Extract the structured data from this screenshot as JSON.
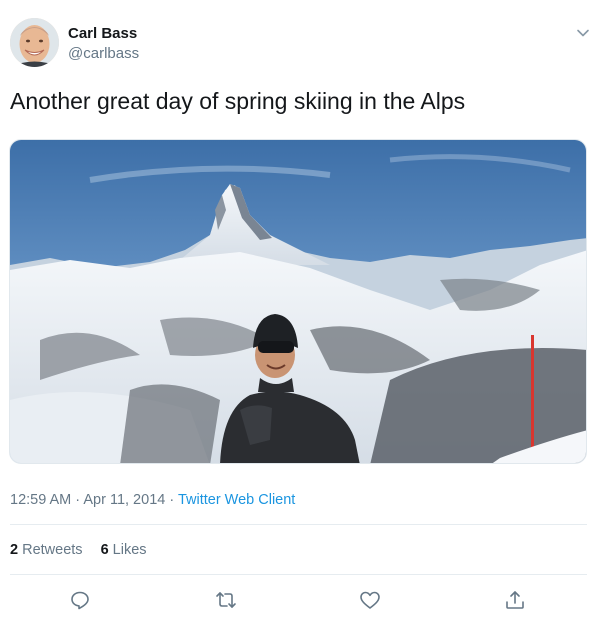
{
  "author": {
    "display_name": "Carl Bass",
    "handle": "@carlbass",
    "avatar_icon": "profile-photo"
  },
  "tweet": {
    "text": "Another great day of spring skiing in the Alps",
    "time": "12:59 AM",
    "separator": " · ",
    "date": "Apr 11, 2014",
    "source": "Twitter Web Client"
  },
  "media": {
    "description_icon": "photo-skier-matterhorn"
  },
  "stats": {
    "retweets_count": "2",
    "retweets_label": " Retweets",
    "likes_count": "6",
    "likes_label": " Likes"
  },
  "actions": [
    {
      "icon": "reply-icon"
    },
    {
      "icon": "retweet-icon"
    },
    {
      "icon": "like-icon"
    },
    {
      "icon": "share-icon"
    }
  ],
  "colors": {
    "text_primary": "#14171a",
    "text_secondary": "#657786",
    "link": "#1b95e0",
    "icon": "#657786",
    "divider": "#e6ecf0"
  }
}
